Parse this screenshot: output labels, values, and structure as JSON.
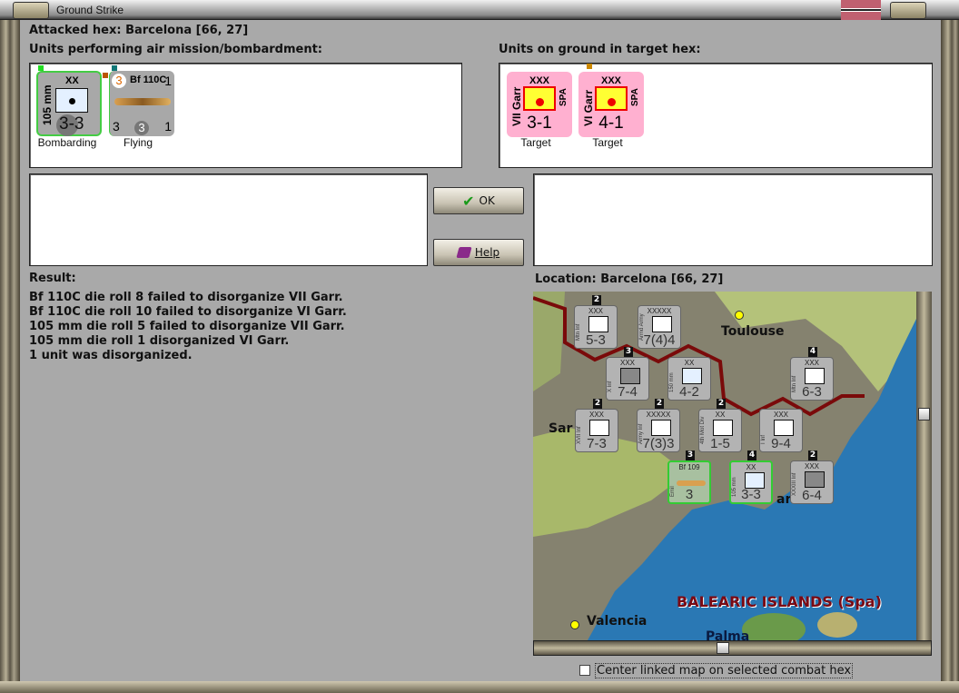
{
  "window": {
    "title": "Ground Strike"
  },
  "attacked_hex": "Attacked hex: Barcelona  [66, 27]",
  "air_units": {
    "heading": "Units performing air mission/bombardment:",
    "units": [
      {
        "name": "105 mm",
        "size": "XX",
        "strength": "3-3",
        "status": "Bombarding"
      },
      {
        "name": "Bf 110C",
        "range": "1",
        "attack": "3",
        "defense": "3",
        "bottom_right": "1",
        "top_badge": "3",
        "status": "Flying"
      }
    ]
  },
  "ground_units": {
    "heading": "Units on ground in target hex:",
    "units": [
      {
        "name": "VII Garr",
        "size": "XXX",
        "nation": "SPA",
        "strength": "3-1",
        "status": "Target"
      },
      {
        "name": "VI Garr",
        "size": "XXX",
        "nation": "SPA",
        "strength": "4-1",
        "status": "Target"
      }
    ]
  },
  "buttons": {
    "ok": "OK",
    "help": "Help"
  },
  "result": {
    "heading": "Result:",
    "lines": [
      "Bf 110C die roll 8 failed to disorganize VII Garr.",
      "Bf 110C die roll 10 failed to disorganize VI Garr.",
      "105 mm die roll 5 failed to disorganize VII Garr.",
      "105 mm die roll 1 disorganized VI Garr.",
      "1 unit was disorganized."
    ]
  },
  "location": "Location:  Barcelona  [66, 27]",
  "map": {
    "labels": {
      "toulouse": "Toulouse",
      "sar": "Sar",
      "valencia": "Valencia",
      "palma": "Palma",
      "region": "BALEARIC ISLANDS (Spa)",
      "bar": "ar"
    },
    "counters": [
      {
        "size": "XXX",
        "name": "Mtn Inf",
        "strength": "5-3",
        "badge": "2",
        "sym": "M"
      },
      {
        "size": "XXXXX",
        "name": "Armd Army",
        "strength": "7(4)4",
        "badge": "",
        "sym": "A"
      },
      {
        "size": "XXX",
        "name": "X Inf",
        "strength": "7-4",
        "badge": "3",
        "sym": "X"
      },
      {
        "size": "XX",
        "name": "150 mm",
        "strength": "4-2",
        "badge": "",
        "sym": "dot"
      },
      {
        "size": "XXX",
        "name": "Mtn Inf",
        "strength": "6-3",
        "badge": "4",
        "sym": "M"
      },
      {
        "size": "XXX",
        "name": "XVII Inf",
        "strength": "7-3",
        "badge": "2",
        "sym": "X"
      },
      {
        "size": "XXXXX",
        "name": "Army Inf",
        "strength": "7(3)3",
        "badge": "2",
        "sym": "X"
      },
      {
        "size": "XX",
        "name": "4th Mot Div",
        "strength": "1-5",
        "badge": "2",
        "sym": "X"
      },
      {
        "size": "XXX",
        "name": "I Inf",
        "strength": "9-4",
        "badge": "",
        "sym": "X"
      },
      {
        "size": "Bf 109",
        "name": "Emil",
        "strength": "3",
        "badge": "3",
        "sym": "air"
      },
      {
        "size": "XX",
        "name": "105 mm",
        "strength": "3-3",
        "badge": "4",
        "sym": "dot"
      },
      {
        "size": "XXX",
        "name": "XXXIII Inf",
        "strength": "6-4",
        "badge": "2",
        "sym": "X"
      }
    ]
  },
  "checkbox": {
    "label": "Center linked map on selected combat hex",
    "checked": false
  },
  "colors": {
    "target_pink": "#ffb0d0",
    "garrison_yellow": "#ffff30",
    "counter_gray": "#a8a8a8",
    "sea": "#2a78b4",
    "border_red": "#7a0a0a"
  }
}
